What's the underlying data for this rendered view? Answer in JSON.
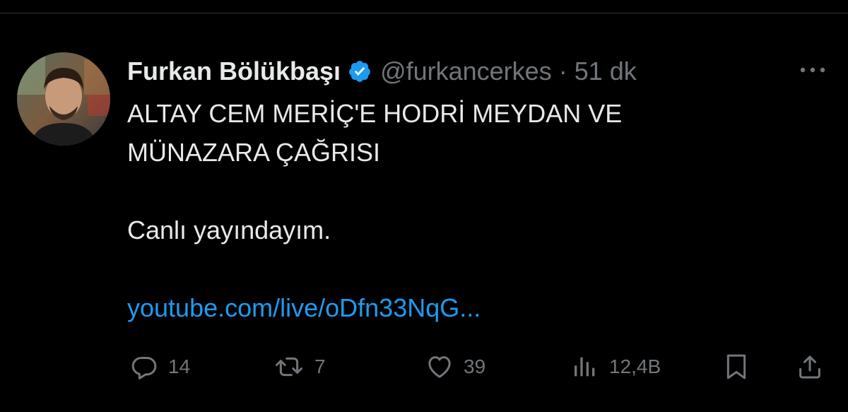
{
  "author": {
    "display_name": "Furkan Bölükbaşı",
    "handle": "@furkancerkes",
    "separator": "·",
    "time": "51 dk",
    "verified": true
  },
  "tweet": {
    "line1": "ALTAY CEM MERİÇ'E HODRİ MEYDAN VE",
    "line2": "MÜNAZARA ÇAĞRISI",
    "line3": "Canlı yayındayım.",
    "link": "youtube.com/live/oDfn33NqG..."
  },
  "actions": {
    "replies": "14",
    "retweets": "7",
    "likes": "39",
    "views": "12,4B"
  },
  "colors": {
    "background": "#000000",
    "text": "#e7e9ea",
    "muted": "#71767b",
    "link": "#1d9bf0",
    "verified": "#1d9bf0"
  },
  "icons": [
    "more-icon",
    "verified-badge-icon",
    "reply-icon",
    "retweet-icon",
    "like-icon",
    "views-icon",
    "bookmark-icon",
    "share-icon"
  ]
}
